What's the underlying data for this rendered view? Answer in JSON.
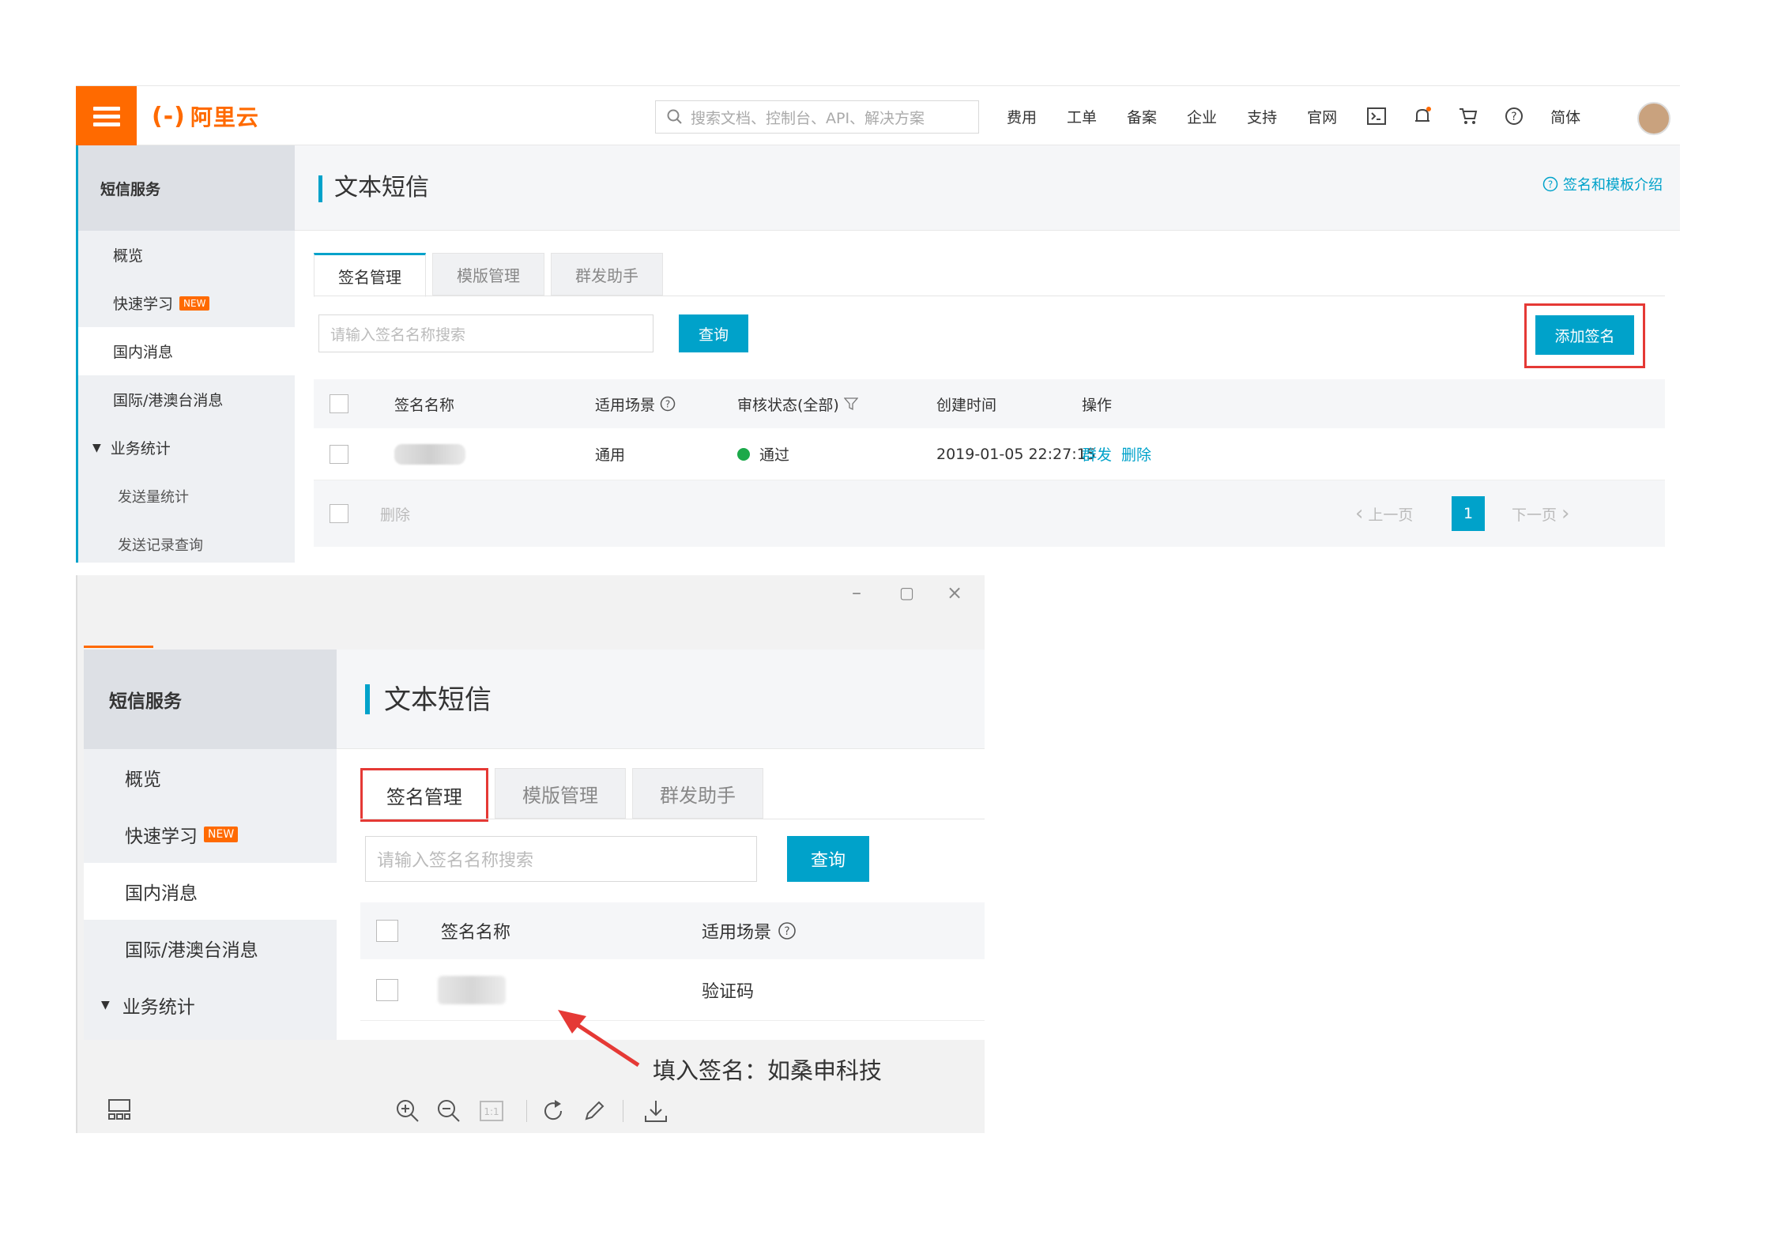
{
  "top": {
    "logo_text": "阿里云",
    "search_placeholder": "搜索文档、控制台、API、解决方案",
    "nav": [
      "费用",
      "工单",
      "备案",
      "企业",
      "支持",
      "官网"
    ],
    "lang": "简体",
    "sidebar": {
      "header": "短信服务",
      "items": [
        "概览",
        "快速学习",
        "国内消息",
        "国际/港澳台消息",
        "业务统计",
        "发送量统计",
        "发送记录查询"
      ],
      "new_badge": "NEW"
    },
    "page_title": "文本短信",
    "help_link": "签名和模板介绍",
    "tabs": [
      "签名管理",
      "模版管理",
      "群发助手"
    ],
    "sig_search_placeholder": "请输入签名名称搜索",
    "query_button": "查询",
    "add_button": "添加签名",
    "table": {
      "headers": [
        "签名名称",
        "适用场景",
        "审核状态(全部)",
        "创建时间",
        "操作"
      ],
      "row": {
        "scene": "通用",
        "status": "通过",
        "created": "2019-01-05 22:27:15",
        "actions": [
          "群发",
          "删除"
        ]
      }
    },
    "footer": {
      "delete": "删除",
      "prev": "上一页",
      "page": "1",
      "next": "下一页"
    },
    "status_color": "#1ca94a",
    "accent": "#00a2ca",
    "brand": "#ff6a00"
  },
  "bottom": {
    "sidebar": {
      "header": "短信服务",
      "items": [
        "概览",
        "快速学习",
        "国内消息",
        "国际/港澳台消息",
        "业务统计"
      ],
      "new_badge": "NEW"
    },
    "page_title": "文本短信",
    "tabs": [
      "签名管理",
      "模版管理",
      "群发助手"
    ],
    "sig_search_placeholder": "请输入签名名称搜索",
    "query_button": "查询",
    "table": {
      "headers": [
        "签名名称",
        "适用场景"
      ],
      "row": {
        "scene": "验证码"
      }
    },
    "annotation": "填入签名：如桑申科技"
  }
}
